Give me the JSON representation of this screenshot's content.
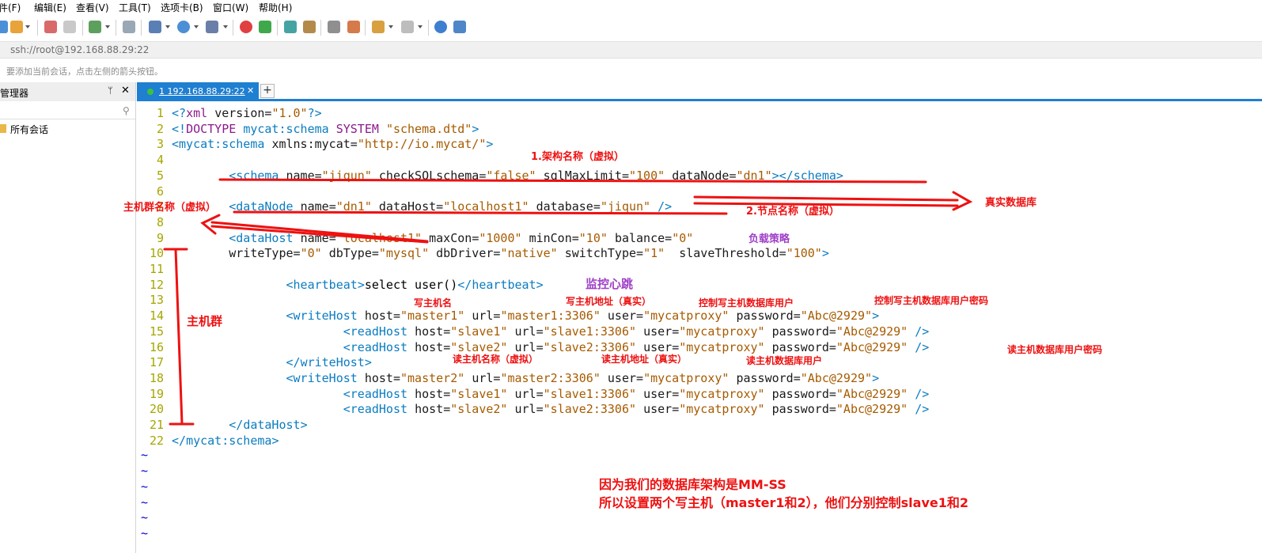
{
  "menu": {
    "items": [
      "文件(F)",
      "编辑(E)",
      "查看(V)",
      "工具(T)",
      "选项卡(B)",
      "窗口(W)",
      "帮助(H)"
    ]
  },
  "address": {
    "value": "ssh://root@192.168.88.29:22",
    "hint": "要添加当前会话，点击左侧的箭头按钮。"
  },
  "session_manager": {
    "title": "会话管理器",
    "pin": "ᛘ",
    "close": "✕",
    "tree": [
      "所有会话"
    ]
  },
  "tabs": [
    {
      "label": "1 192.168.88.29:22",
      "close": "✕"
    }
  ],
  "tab_add": "+",
  "editor": {
    "lines": [
      {
        "n": "1",
        "code": "<?xml version=\"1.0\"?>"
      },
      {
        "n": "2",
        "code": "<!DOCTYPE mycat:schema SYSTEM \"schema.dtd\">"
      },
      {
        "n": "3",
        "code": "<mycat:schema xmlns:mycat=\"http://io.mycat/\">"
      },
      {
        "n": "4",
        "code": ""
      },
      {
        "n": "5",
        "code": "        <schema name=\"jiqun\" checkSQLschema=\"false\" sqlMaxLimit=\"100\" dataNode=\"dn1\"></schema>"
      },
      {
        "n": "6",
        "code": ""
      },
      {
        "n": "7",
        "code": "        <dataNode name=\"dn1\" dataHost=\"localhost1\" database=\"jiqun\" />"
      },
      {
        "n": "8",
        "code": ""
      },
      {
        "n": "9",
        "code": "        <dataHost name=\"localhost1\" maxCon=\"1000\" minCon=\"10\" balance=\"0\""
      },
      {
        "n": "10",
        "code": "        writeType=\"0\" dbType=\"mysql\" dbDriver=\"native\" switchType=\"1\"  slaveThreshold=\"100\">"
      },
      {
        "n": "11",
        "code": ""
      },
      {
        "n": "12",
        "code": "                <heartbeat>select user()</heartbeat>"
      },
      {
        "n": "13",
        "code": ""
      },
      {
        "n": "14",
        "code": "                <writeHost host=\"master1\" url=\"master1:3306\" user=\"mycatproxy\" password=\"Abc@2929\">"
      },
      {
        "n": "15",
        "code": "                        <readHost host=\"slave1\" url=\"slave1:3306\" user=\"mycatproxy\" password=\"Abc@2929\" />"
      },
      {
        "n": "16",
        "code": "                        <readHost host=\"slave2\" url=\"slave2:3306\" user=\"mycatproxy\" password=\"Abc@2929\" />"
      },
      {
        "n": "17",
        "code": "                </writeHost>"
      },
      {
        "n": "18",
        "code": "                <writeHost host=\"master2\" url=\"master2:3306\" user=\"mycatproxy\" password=\"Abc@2929\">"
      },
      {
        "n": "19",
        "code": "                        <readHost host=\"slave1\" url=\"slave1:3306\" user=\"mycatproxy\" password=\"Abc@2929\" />"
      },
      {
        "n": "20",
        "code": "                        <readHost host=\"slave2\" url=\"slave2:3306\" user=\"mycatproxy\" password=\"Abc@2929\" />"
      },
      {
        "n": "21",
        "code": "        </dataHost>"
      },
      {
        "n": "22",
        "code": "</mycat:schema>"
      }
    ],
    "tilde": "~",
    "tilde_count": 6
  },
  "annotations": {
    "schema_name": "1.架构名称（虚拟）",
    "real_db": "真实数据库",
    "host_group_name": "主机群名称（虚拟）",
    "node_name": "2.节点名称（虚拟）",
    "balance": "负载策略",
    "heartbeat": "监控心跳",
    "host_group": "主机群",
    "write_host_name": "写主机名",
    "write_host_addr": "写主机地址（真实）",
    "write_db_user": "控制写主机数据库用户",
    "write_db_pwd": "控制写主机数据库用户密码",
    "read_db_pwd": "读主机数据库用户密码",
    "read_host_name": "读主机名称（虚拟）",
    "read_host_addr": "读主机地址（真实）",
    "read_db_user": "读主机数据库用户",
    "note_line1": "因为我们的数据库架构是MM-SS",
    "note_line2": "所以设置两个写主机（master1和2），他们分别控制slave1和2"
  },
  "colors": {
    "annotation_red": "#ee1111",
    "annotation_purple": "#a040c8",
    "tab_active": "#1f7fd1",
    "line_number": "#a6a600",
    "xml_tag": "#0b7cc1",
    "xml_value": "#a65b00"
  },
  "icons": [
    "new-session-icon",
    "open-folder-icon",
    "connect-icon",
    "disconnect-icon",
    "properties-icon",
    "find-icon",
    "transfer-icon",
    "globe-icon",
    "font-icon",
    "xftp-icon",
    "tunnel-icon",
    "fullscreen-icon",
    "lock-icon",
    "keyboard-icon",
    "highlight-icon",
    "compose-icon",
    "layout-icon",
    "help-icon",
    "chat-icon"
  ]
}
